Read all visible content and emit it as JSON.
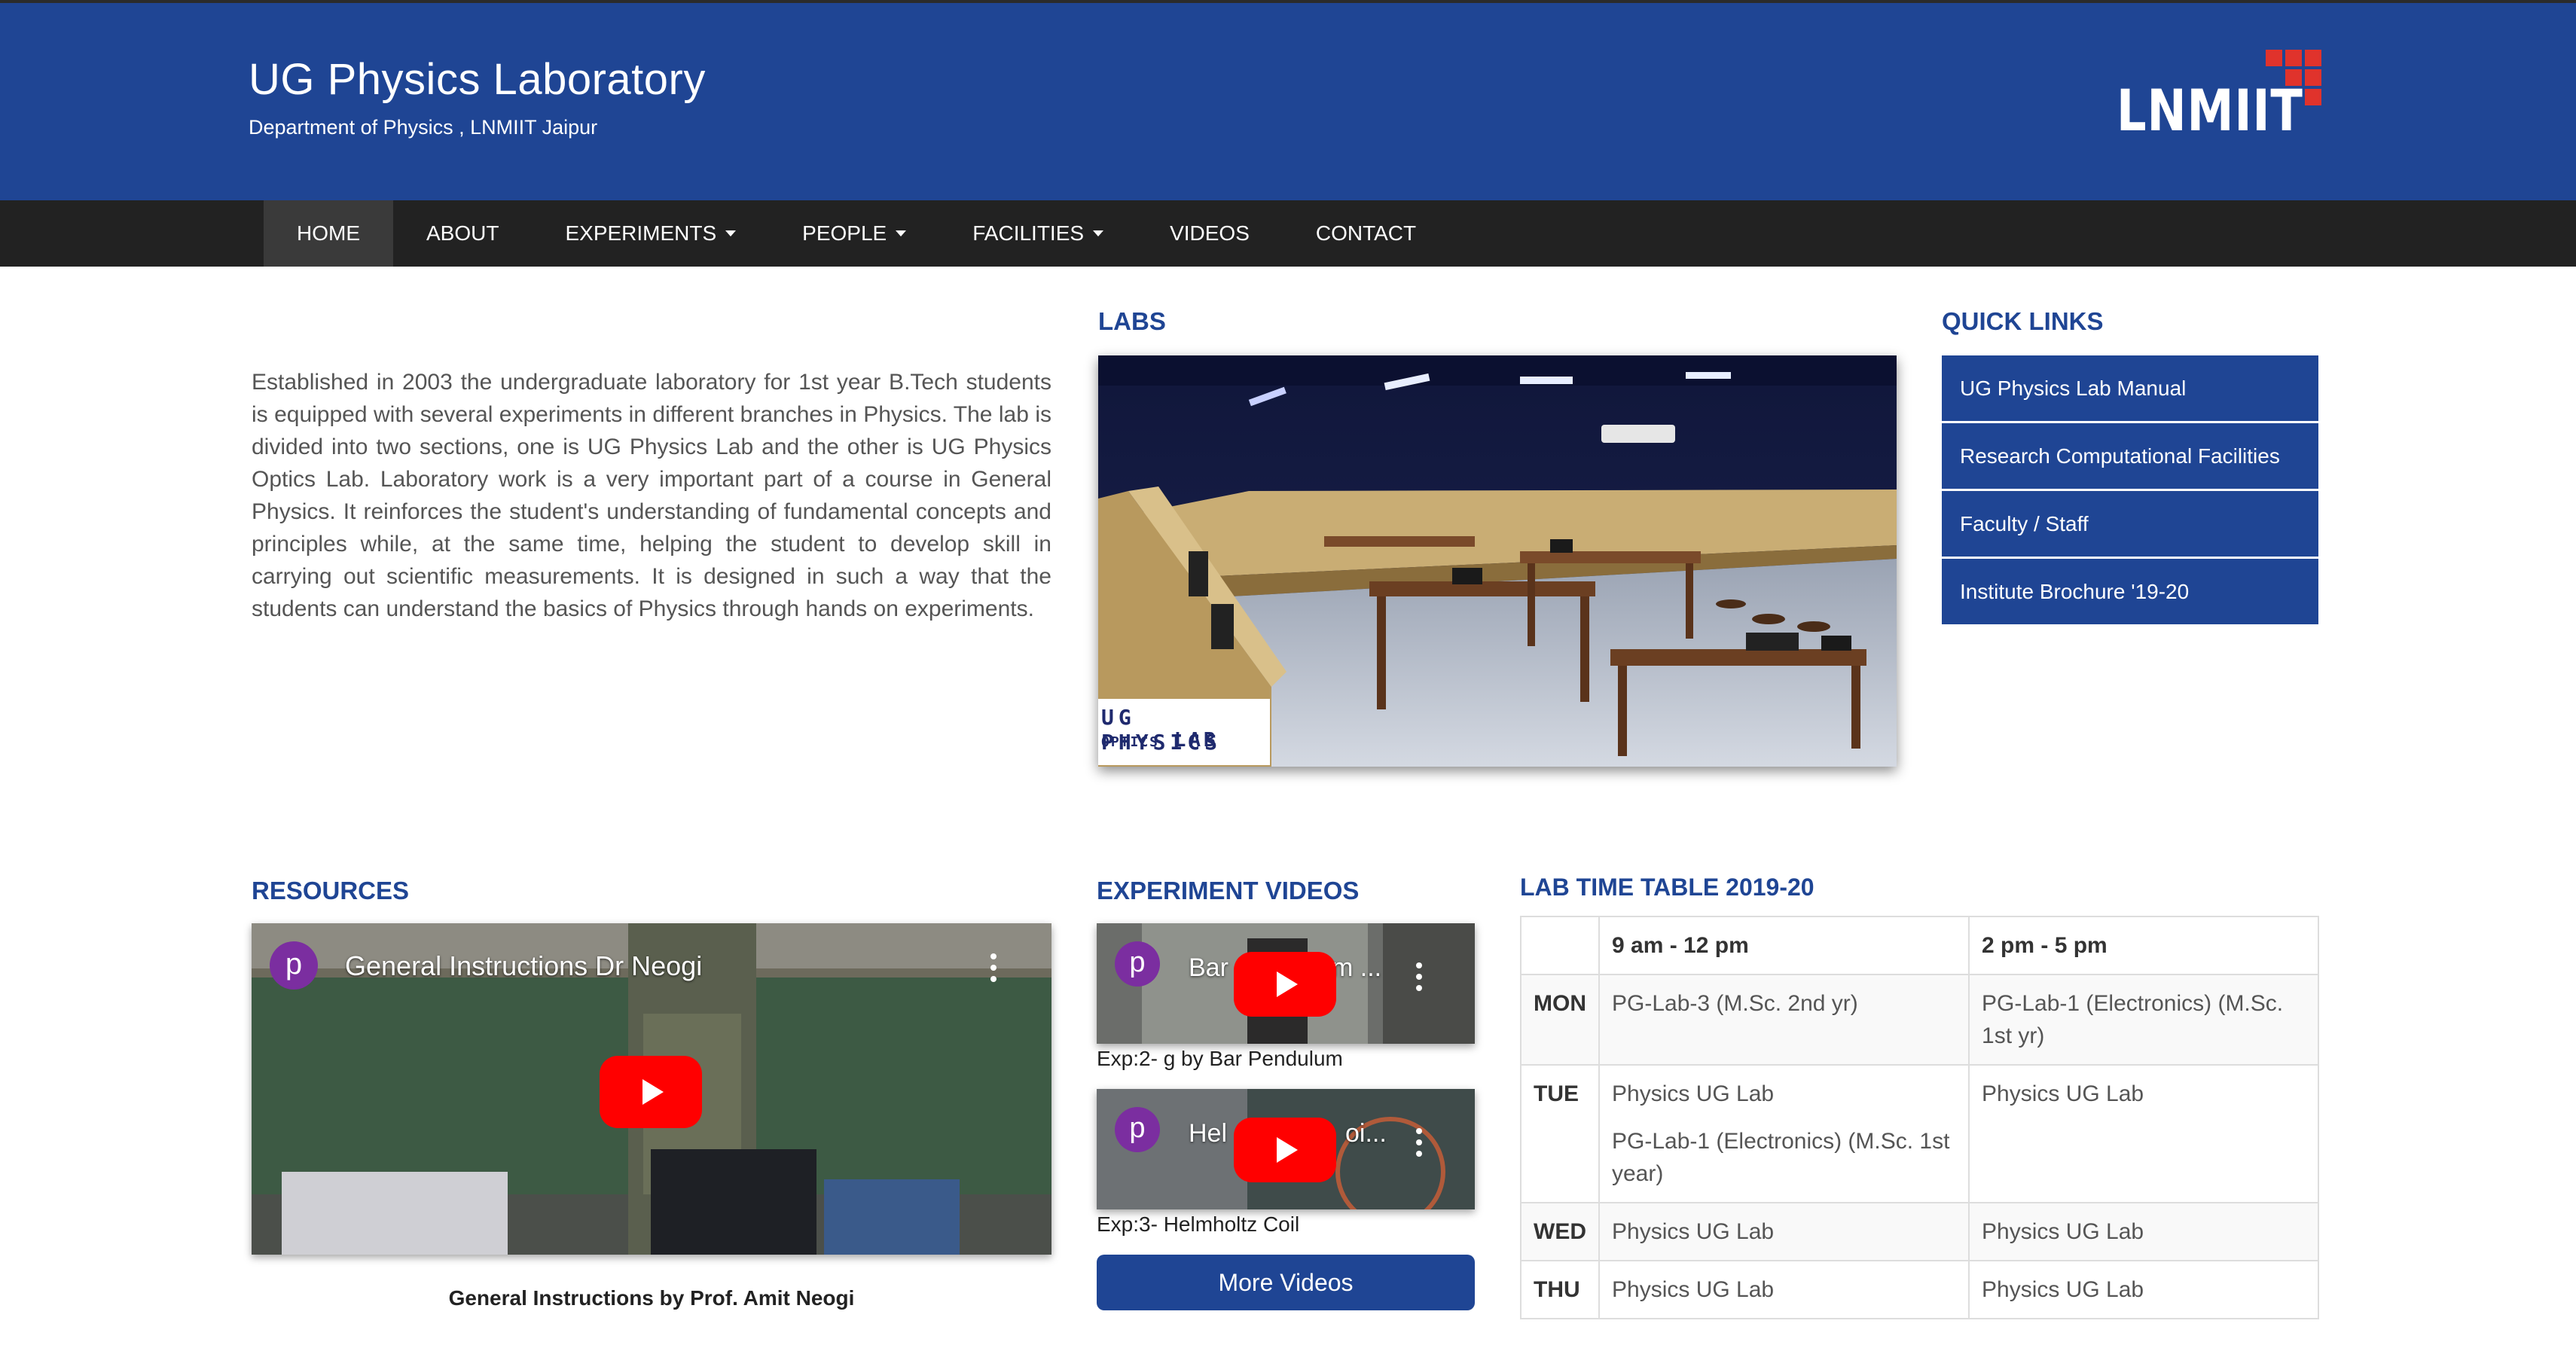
{
  "header": {
    "title": "UG Physics Laboratory",
    "subtitle": "Department of Physics , LNMIIT Jaipur",
    "logo_text": "LNMIIT"
  },
  "nav": {
    "items": [
      {
        "label": "HOME",
        "active": true,
        "dropdown": false
      },
      {
        "label": "ABOUT",
        "dropdown": false
      },
      {
        "label": "EXPERIMENTS",
        "dropdown": true
      },
      {
        "label": "PEOPLE",
        "dropdown": true
      },
      {
        "label": "FACILITIES",
        "dropdown": true
      },
      {
        "label": "VIDEOS",
        "dropdown": false
      },
      {
        "label": "CONTACT",
        "dropdown": false
      }
    ]
  },
  "intro": {
    "text": "Established in 2003 the undergraduate laboratory for 1st year B.Tech students is equipped with several experiments in different branches in Physics. The lab is divided into two sections, one is UG Physics Lab and the other is UG Physics Optics Lab. Laboratory work is a very important part of a course in General Physics. It reinforces the student's understanding of fundamental concepts and principles while, at the same time, helping the student to develop skill in carrying out scientific measurements. It is designed in such a way that the students can understand the basics of Physics through hands on experiments."
  },
  "labs": {
    "heading": "LABS",
    "photo_caption_line1": "UG PHYSICS",
    "photo_caption_line2_small": "OPTICS",
    "photo_caption_line2": "LAB"
  },
  "quick_links": {
    "heading": "QUICK LINKS",
    "items": [
      {
        "label": "UG Physics Lab Manual"
      },
      {
        "label": "Research Computational Facilities"
      },
      {
        "label": "Faculty / Staff"
      },
      {
        "label": "Institute Brochure '19-20"
      }
    ]
  },
  "resources": {
    "heading": "RESOURCES",
    "video": {
      "channel_initial": "p",
      "title": "General Instructions Dr Neogi"
    },
    "caption": "General Instructions by Prof. Amit Neogi"
  },
  "experiment_videos": {
    "heading": "EXPERIMENT VIDEOS",
    "videos": [
      {
        "channel_initial": "p",
        "title_left": "Bar",
        "title_right": "m ...",
        "caption": "Exp:2- g by Bar Pendulum"
      },
      {
        "channel_initial": "p",
        "title_left": "Hel",
        "title_right": "oi...",
        "caption": "Exp:3- Helmholtz Coil"
      }
    ],
    "more_button": "More Videos"
  },
  "timetable": {
    "heading": "LAB TIME TABLE 2019-20",
    "headers": [
      "",
      "9 am - 12 pm",
      "2 pm - 5 pm"
    ],
    "rows": [
      {
        "day": "MON",
        "morning": [
          "PG-Lab-3 (M.Sc. 2nd yr)"
        ],
        "afternoon": [
          "PG-Lab-1 (Electronics) (M.Sc. 1st yr)"
        ]
      },
      {
        "day": "TUE",
        "morning": [
          "Physics UG Lab",
          "PG-Lab-1 (Electronics) (M.Sc. 1st year)"
        ],
        "afternoon": [
          "Physics UG Lab"
        ]
      },
      {
        "day": "WED",
        "morning": [
          "Physics UG Lab"
        ],
        "afternoon": [
          "Physics UG Lab"
        ]
      },
      {
        "day": "THU",
        "morning": [
          "Physics UG Lab"
        ],
        "afternoon": [
          "Physics UG Lab"
        ]
      }
    ]
  },
  "colors": {
    "brand_blue": "#1f4594",
    "nav_bg": "#222222",
    "logo_red": "#e0332c",
    "youtube_red": "#ff0000",
    "channel_purple": "#7b2ea0"
  }
}
